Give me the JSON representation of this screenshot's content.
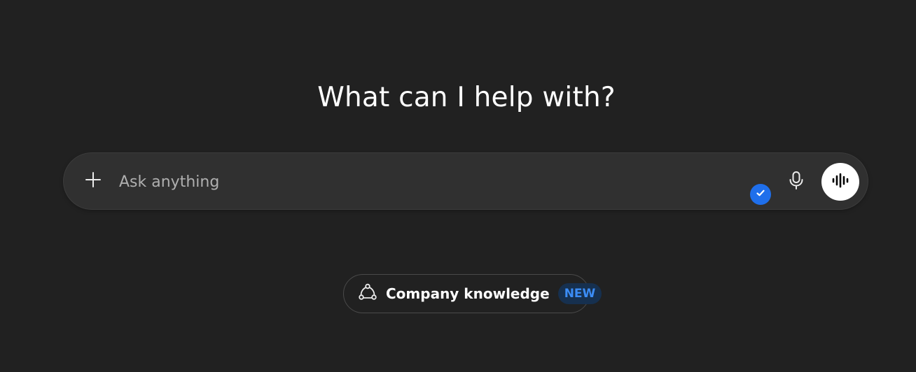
{
  "main": {
    "heading": "What can I help with?"
  },
  "composer": {
    "placeholder": "Ask anything",
    "value": ""
  },
  "chip": {
    "label": "Company knowledge",
    "badge": "NEW"
  },
  "icons": {
    "plus": "plus-icon",
    "mic": "microphone-icon",
    "voice": "voice-waveform-icon",
    "check": "check-icon",
    "knowledge": "connections-icon"
  },
  "colors": {
    "background": "#212121",
    "composer_bg": "#303030",
    "accent_blue": "#1f6feb",
    "badge_text": "#3b8cf5",
    "badge_bg": "#16304f"
  }
}
